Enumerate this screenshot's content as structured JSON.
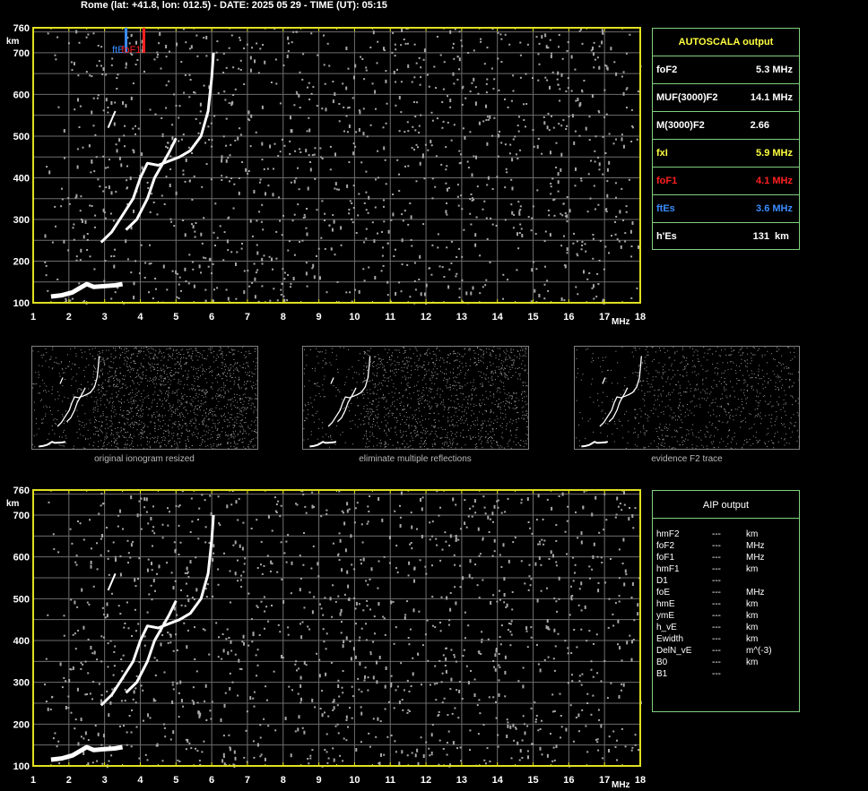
{
  "header": {
    "title": "Rome (lat: +41.8, lon: 012.5) - DATE: 2025 05 29 - TIME (UT): 05:15"
  },
  "colors": {
    "frame": "#e0e020",
    "grid": "#6e6e6e",
    "trace": "#ffffff",
    "noise": "#a8a8a8",
    "panel_border": "#7fd07f",
    "yellow": "#ffff40",
    "red": "#ff2020",
    "blue": "#3a8cff"
  },
  "autoscala": {
    "title": "AUTOSCALA output",
    "rows": [
      {
        "label": "foF2",
        "value": "5.3 MHz",
        "color": "#ffffff"
      },
      {
        "label": "MUF(3000)F2",
        "value": "14.1 MHz",
        "color": "#ffffff"
      },
      {
        "label": "M(3000)F2",
        "value": "2.66",
        "color": "#ffffff"
      },
      {
        "label": "fxI",
        "value": "5.9 MHz",
        "color": "#ffff40"
      },
      {
        "label": "foF1",
        "value": "4.1 MHz",
        "color": "#ff2020"
      },
      {
        "label": "ftEs",
        "value": "3.6 MHz",
        "color": "#3a8cff"
      },
      {
        "label": "h'Es",
        "value": "131",
        "unit": "km",
        "color": "#ffffff"
      }
    ]
  },
  "aip": {
    "title": "AIP output",
    "rows": [
      {
        "name": "hmF2",
        "value": "---",
        "unit": "km"
      },
      {
        "name": "foF2",
        "value": "---",
        "unit": "MHz"
      },
      {
        "name": "foF1",
        "value": "---",
        "unit": "MHz"
      },
      {
        "name": "hmF1",
        "value": "---",
        "unit": "km"
      },
      {
        "name": "D1",
        "value": "---",
        "unit": ""
      },
      {
        "name": "foE",
        "value": "---",
        "unit": "MHz"
      },
      {
        "name": "hmE",
        "value": "---",
        "unit": "km"
      },
      {
        "name": "ymE",
        "value": "---",
        "unit": "km"
      },
      {
        "name": "h_vE",
        "value": "---",
        "unit": "km"
      },
      {
        "name": "Ewidth",
        "value": "---",
        "unit": "km"
      },
      {
        "name": "DelN_vE",
        "value": "---",
        "unit": "m^(-3)"
      },
      {
        "name": "B0",
        "value": "---",
        "unit": "km"
      },
      {
        "name": "B1",
        "value": "---",
        "unit": ""
      }
    ]
  },
  "captions": {
    "thumb1": "original ionogram resized",
    "thumb2": "eliminate multiple reflections",
    "thumb3": "evidence F2 trace"
  },
  "chart_data": [
    {
      "type": "scatter",
      "role": "ionogram-top",
      "xlabel": "MHz",
      "ylabel": "km",
      "xlim": [
        1,
        18
      ],
      "ylim": [
        100,
        760
      ],
      "x_ticks": [
        "1",
        "2",
        "3",
        "4",
        "5",
        "6",
        "7",
        "8",
        "9",
        "10",
        "11",
        "12",
        "13",
        "14",
        "15",
        "16",
        "17",
        "18"
      ],
      "y_ticks": [
        "760",
        "700",
        "600",
        "500",
        "400",
        "300",
        "200",
        "100"
      ],
      "grid": true,
      "markers": [
        {
          "label": "ftE",
          "x": 3.6,
          "color": "#3a8cff"
        },
        {
          "label": "foF1",
          "x": 4.1,
          "color": "#ff2020"
        }
      ],
      "traces": {
        "es_layer": [
          [
            1.5,
            115
          ],
          [
            1.8,
            118
          ],
          [
            2.1,
            125
          ],
          [
            2.3,
            135
          ],
          [
            2.5,
            145
          ],
          [
            2.7,
            138
          ],
          [
            3.0,
            140
          ],
          [
            3.3,
            142
          ],
          [
            3.5,
            145
          ]
        ],
        "f_ordinary": [
          [
            2.9,
            245
          ],
          [
            3.2,
            270
          ],
          [
            3.5,
            310
          ],
          [
            3.8,
            350
          ],
          [
            4.0,
            400
          ],
          [
            4.2,
            435
          ],
          [
            4.5,
            430
          ],
          [
            4.8,
            440
          ],
          [
            5.1,
            450
          ],
          [
            5.4,
            465
          ],
          [
            5.7,
            500
          ],
          [
            5.9,
            560
          ],
          [
            6.0,
            640
          ],
          [
            6.05,
            700
          ]
        ],
        "f_extraordinary": [
          [
            3.6,
            275
          ],
          [
            3.9,
            300
          ],
          [
            4.2,
            350
          ],
          [
            4.4,
            400
          ],
          [
            4.6,
            430
          ],
          [
            4.8,
            460
          ],
          [
            5.0,
            495
          ]
        ],
        "spur": [
          [
            3.1,
            520
          ],
          [
            3.3,
            560
          ]
        ]
      }
    },
    {
      "type": "scatter",
      "role": "ionogram-bottom",
      "xlabel": "MHz",
      "ylabel": "km",
      "xlim": [
        1,
        18
      ],
      "ylim": [
        100,
        760
      ],
      "x_ticks": [
        "1",
        "2",
        "3",
        "4",
        "5",
        "6",
        "7",
        "8",
        "9",
        "10",
        "11",
        "12",
        "13",
        "14",
        "15",
        "16",
        "17",
        "18"
      ],
      "y_ticks": [
        "760",
        "700",
        "600",
        "500",
        "400",
        "300",
        "200",
        "100"
      ],
      "grid": true
    }
  ]
}
